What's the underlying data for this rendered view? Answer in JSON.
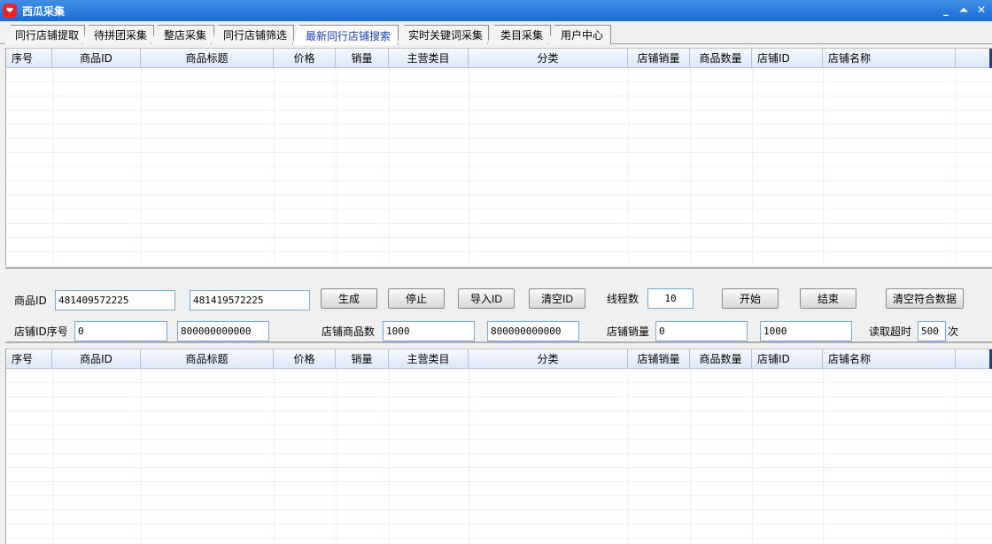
{
  "window": {
    "title": "西瓜采集",
    "app_icon": "melon-logo-icon",
    "accent": "#1a6cd4"
  },
  "tabs": [
    {
      "label": "同行店铺提取"
    },
    {
      "label": "待拼团采集"
    },
    {
      "label": "整店采集"
    },
    {
      "label": "同行店铺筛选"
    },
    {
      "label": "最新同行店铺搜索",
      "active": true
    },
    {
      "label": "实时关键词采集"
    },
    {
      "label": "类目采集"
    },
    {
      "label": "用户中心"
    }
  ],
  "table_columns": [
    "序号",
    "商品ID",
    "商品标题",
    "价格",
    "销量",
    "主营类目",
    "分类",
    "店铺销量",
    "商品数量",
    "店铺ID",
    "店铺名称"
  ],
  "controls": {
    "product_id_label": "商品ID",
    "product_id_from": "481409572225",
    "product_id_to": "481419572225",
    "generate_btn": "生成",
    "stop_btn": "停止",
    "import_id_btn": "导入ID",
    "clear_id_btn": "清空ID",
    "threads_label": "线程数",
    "threads_value": "10",
    "start_btn": "开始",
    "end_btn": "结束",
    "clear_matched_btn": "清空符合数据",
    "shop_id_seq_label": "店铺ID序号",
    "shop_id_from": "0",
    "shop_id_to": "800000000000",
    "shop_goods_label": "店铺商品数",
    "shop_goods_from": "1000",
    "shop_goods_to": "800000000000",
    "shop_sales_label": "店铺销量",
    "shop_sales_from": "0",
    "shop_sales_to": "1000",
    "timeout_label": "读取超时",
    "timeout_value": "500",
    "timeout_unit": "次"
  }
}
